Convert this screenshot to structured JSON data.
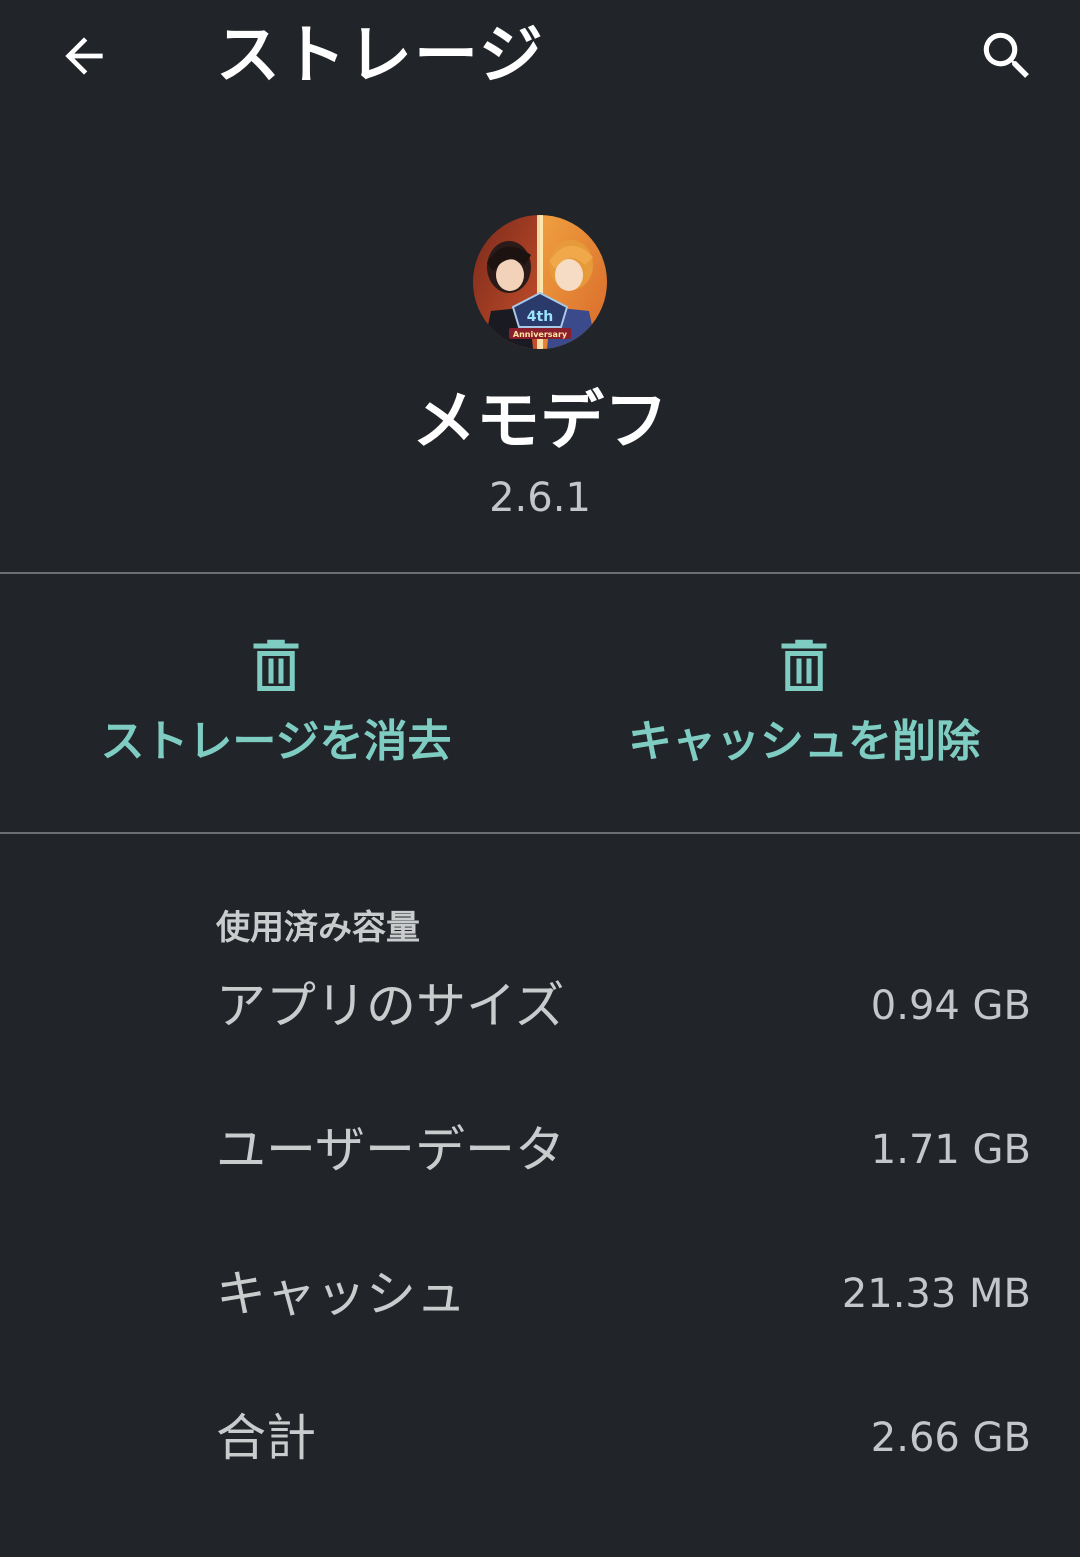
{
  "appbar": {
    "title": "ストレージ",
    "back_icon": "arrow-back-icon",
    "search_icon": "search-icon"
  },
  "app": {
    "icon": "app-icon",
    "name": "メモデフ",
    "version": "2.6.1"
  },
  "actions": [
    {
      "label": "ストレージを消去",
      "icon": "trash-icon"
    },
    {
      "label": "キャッシュを削除",
      "icon": "trash-icon"
    }
  ],
  "storage": {
    "section_title": "使用済み容量",
    "rows": [
      {
        "label": "アプリのサイズ",
        "value": "0.94 GB"
      },
      {
        "label": "ユーザーデータ",
        "value": "1.71 GB"
      },
      {
        "label": "キャッシュ",
        "value": "21.33 MB"
      },
      {
        "label": "合計",
        "value": "2.66 GB"
      }
    ]
  },
  "colors": {
    "background": "#212529",
    "accent": "#7fcdc2",
    "divider": "#6b6f72",
    "secondary_text": "#c4c7c9"
  }
}
